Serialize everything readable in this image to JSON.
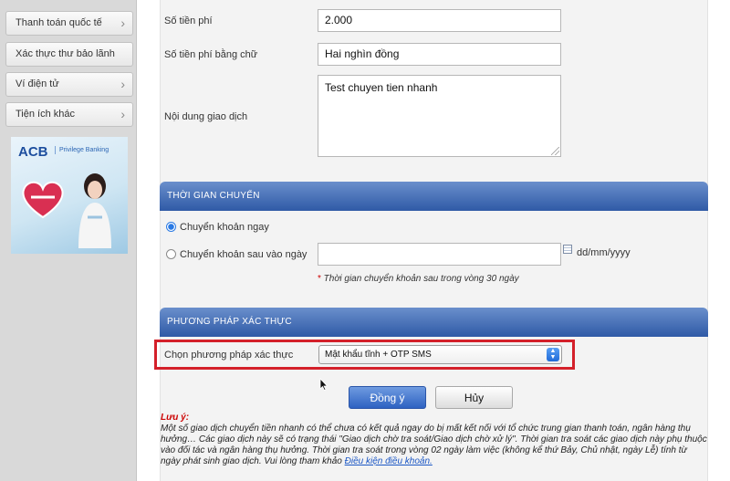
{
  "sidebar": {
    "items": [
      {
        "label": "Thanh toán quốc tế"
      },
      {
        "label": "Xác thực thư bảo lãnh"
      },
      {
        "label": "Ví điện tử"
      },
      {
        "label": "Tiện ích khác"
      }
    ],
    "banner": {
      "logo": "ACB",
      "brand": "Privilege Banking"
    }
  },
  "form": {
    "fee_label": "Số tiền phí",
    "fee_value": "2.000",
    "fee_words_label": "Số tiền phí bằng chữ",
    "fee_words_value": "Hai nghìn đồng",
    "content_label": "Nội dung giao dịch",
    "content_value": "Test chuyen tien nhanh"
  },
  "transfer_time": {
    "header": "THỜI GIAN CHUYỂN",
    "option_now": "Chuyển khoản ngay",
    "option_later": "Chuyển khoản sau vào ngày",
    "selected": "option_now",
    "date_value": "",
    "date_format": "dd/mm/yyyy",
    "note": "Thời gian chuyển khoản sau trong vòng 30 ngày"
  },
  "auth": {
    "header": "PHƯƠNG PHÁP XÁC THỰC",
    "label": "Chọn phương pháp xác thực",
    "selected": "Mật khẩu tĩnh + OTP SMS"
  },
  "buttons": {
    "confirm": "Đồng ý",
    "cancel": "Hủy"
  },
  "notes": {
    "title": "Lưu ý:",
    "body": "Một số giao dịch chuyển tiền nhanh có thể chưa có kết quả ngay do bị mất kết nối với tổ chức trung gian thanh toán, ngân hàng thụ hưởng… Các giao dịch này sẽ có trạng thái \"Giao dịch chờ tra soát/Giao dịch chờ xử lý\". Thời gian tra soát các giao dịch này phụ thuộc vào đối tác và ngân hàng thụ hưởng. Thời gian tra soát trong vòng 02 ngày làm việc (không kể thứ Bảy, Chủ nhật, ngày Lễ) tính từ ngày phát sinh giao dịch. Vui lòng tham khảo ",
    "link": "Điều kiện điều khoản."
  },
  "colors": {
    "header_blue": "#2f5aa6",
    "highlight_red": "#d4202a",
    "note_red": "#cc0000",
    "link_blue": "#1a56c4"
  }
}
